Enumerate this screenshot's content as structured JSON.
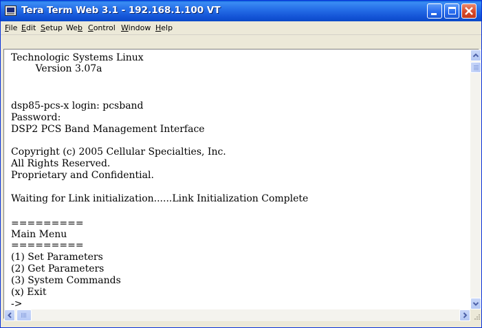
{
  "window": {
    "title": "Tera Term Web 3.1 - 192.168.1.100 VT",
    "icon": "terminal-app-icon"
  },
  "menu": {
    "items": [
      "File",
      "Edit",
      "Setup",
      "Web",
      "Control",
      "Window",
      "Help"
    ],
    "mnemonics": [
      "F",
      "E",
      "S",
      "b",
      "C",
      "W",
      "H"
    ]
  },
  "terminal": {
    "lines": [
      "Technologic Systems Linux",
      "        Version 3.07a",
      "",
      "",
      "dsp85-pcs-x login: pcsband",
      "Password:",
      "DSP2 PCS Band Management Interface",
      "",
      "Copyright (c) 2005 Cellular Specialties, Inc.",
      "All Rights Reserved.",
      "Proprietary and Confidential.",
      "",
      "Waiting for Link initialization......Link Initialization Complete",
      "",
      "=========",
      "Main Menu",
      "=========",
      "(1) Set Parameters",
      "(2) Get Parameters",
      "(3) System Commands",
      "(x) Exit",
      "->"
    ]
  },
  "colors": {
    "titlebar": "#2770e8",
    "terminal_bg": "#ffffff",
    "terminal_text": "#000000",
    "close_button": "#d6482a"
  }
}
